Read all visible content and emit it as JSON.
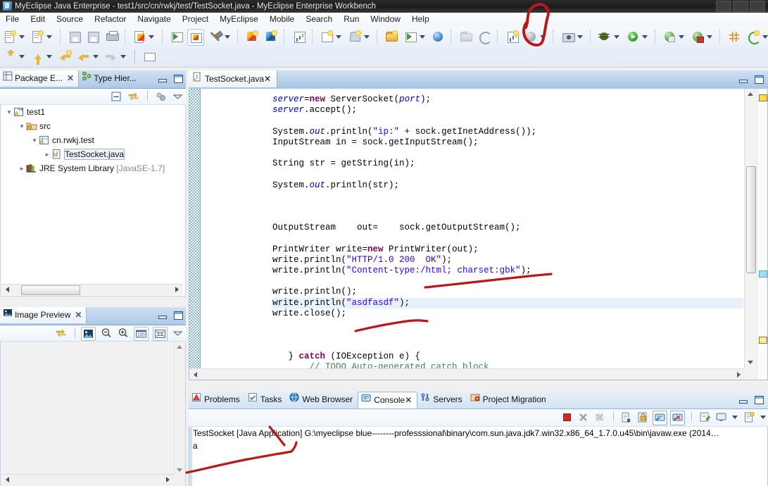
{
  "window": {
    "title": "MyEclipse Java Enterprise - test1/src/cn/rwkj/test/TestSocket.java - MyEclipse Enterprise Workbench",
    "app_icon": "myeclipse-icon"
  },
  "menubar": {
    "items": [
      "File",
      "Edit",
      "Source",
      "Refactor",
      "Navigate",
      "Project",
      "MyEclipse",
      "Mobile",
      "Search",
      "Run",
      "Window",
      "Help"
    ]
  },
  "toolbar": {
    "row1": [
      {
        "name": "new-wizard-button",
        "icon": "new-file-icon",
        "dropdown": true
      },
      {
        "name": "new-java-class-button",
        "icon": "new-class-icon",
        "dropdown": true
      },
      {
        "name": "save-button",
        "icon": "save-icon",
        "dropdown": false,
        "disabled": true
      },
      {
        "name": "save-all-button",
        "icon": "save-all-icon",
        "dropdown": false,
        "disabled": true
      },
      {
        "name": "print-button",
        "icon": "print-icon",
        "dropdown": false
      },
      {
        "name": "deploy-button",
        "icon": "deploy-icon",
        "dropdown": true
      },
      {
        "name": "run-server-button",
        "icon": "server-run-icon",
        "dropdown": false
      },
      {
        "name": "stop-server-button",
        "icon": "server-stop-icon",
        "dropdown": false,
        "framed": true
      },
      {
        "name": "build-button",
        "icon": "hammer-icon",
        "dropdown": true
      },
      {
        "name": "new-package-button",
        "icon": "package-yellow-icon",
        "dropdown": false
      },
      {
        "name": "new-jar-button",
        "icon": "package-blue-icon",
        "dropdown": false
      },
      {
        "name": "browser-20-button",
        "icon": "web-20-icon",
        "dropdown": false
      },
      {
        "name": "new-ui-button",
        "icon": "ui-wizard-icon",
        "dropdown": true
      },
      {
        "name": "new-db-wizard-button",
        "icon": "db-wizard-icon",
        "dropdown": true
      },
      {
        "name": "new-server-button",
        "icon": "server-new-icon",
        "dropdown": false
      },
      {
        "name": "run-server-green-button",
        "icon": "server-green-run-icon",
        "dropdown": true
      },
      {
        "name": "open-browser-button",
        "icon": "globe-icon",
        "dropdown": false
      },
      {
        "name": "open-folder-button",
        "icon": "open-folder-icon",
        "dropdown": false,
        "disabled": true
      },
      {
        "name": "refresh-button",
        "icon": "refresh-icon",
        "dropdown": false
      },
      {
        "name": "report-button",
        "icon": "report-icon",
        "dropdown": false
      },
      {
        "name": "globe-disabled-button",
        "icon": "globe-disabled-icon",
        "dropdown": true
      },
      {
        "name": "snapshot-button",
        "icon": "camera-icon",
        "dropdown": true
      },
      {
        "name": "debug-button",
        "icon": "debug-bug-icon",
        "dropdown": true
      },
      {
        "name": "run-button",
        "icon": "run-green-play-icon",
        "dropdown": true,
        "highlighted": true
      },
      {
        "name": "run-config-button",
        "icon": "run-config-icon",
        "dropdown": true
      },
      {
        "name": "run-external-button",
        "icon": "run-external-icon",
        "dropdown": true
      },
      {
        "name": "new-table-button",
        "icon": "table-grid-icon",
        "dropdown": false
      },
      {
        "name": "generate-button",
        "icon": "generate-circle-icon",
        "dropdown": true
      },
      {
        "name": "open-type-button",
        "icon": "open-type-icon",
        "dropdown": false
      },
      {
        "name": "open-resource-button",
        "icon": "open-resource-icon",
        "dropdown": false
      },
      {
        "name": "search-button",
        "icon": "pen-search-icon",
        "dropdown": true
      },
      {
        "name": "open-task-button",
        "icon": "task-icon",
        "dropdown": false
      },
      {
        "name": "team-sync-button",
        "icon": "team-sync-icon",
        "dropdown": false
      },
      {
        "name": "perspective-button",
        "icon": "perspective-icon",
        "dropdown": false,
        "framed": true
      }
    ],
    "row2": [
      {
        "name": "prev-annotation-button",
        "icon": "arrow-down-yellow-icon",
        "dropdown": true
      },
      {
        "name": "next-annotation-button",
        "icon": "arrow-up-yellow-icon",
        "dropdown": true
      },
      {
        "name": "last-edit-button",
        "icon": "back-edit-icon",
        "dropdown": false
      },
      {
        "name": "back-button",
        "icon": "back-arrow-icon",
        "dropdown": true
      },
      {
        "name": "forward-button",
        "icon": "forward-arrow-icon",
        "dropdown": true,
        "disabled": true
      },
      {
        "name": "new-untitled-button",
        "icon": "new-untitled-icon",
        "dropdown": false
      }
    ]
  },
  "package_explorer": {
    "tabs": [
      {
        "label": "Package E...",
        "icon": "package-explorer-icon",
        "active": true,
        "closable": true
      },
      {
        "label": "Type Hier...",
        "icon": "type-hierarchy-icon",
        "active": false,
        "closable": false
      }
    ],
    "view_buttons": [
      {
        "name": "collapse-all-button",
        "icon": "collapse-all-icon"
      },
      {
        "name": "link-with-editor-button",
        "icon": "link-editor-icon"
      },
      {
        "name": "focus-on-active-task-button",
        "icon": "focus-task-icon"
      },
      {
        "name": "view-menu-button",
        "icon": "view-menu-chevron-icon"
      }
    ],
    "tree": [
      {
        "label": "test1",
        "indent": 0,
        "twist": "expanded",
        "icon": "java-project-icon",
        "dim": "",
        "selected": false
      },
      {
        "label": "src",
        "indent": 1,
        "twist": "expanded",
        "icon": "source-folder-icon",
        "dim": "",
        "selected": false
      },
      {
        "label": "cn.rwkj.test",
        "indent": 2,
        "twist": "expanded",
        "icon": "package-icon",
        "dim": "",
        "selected": false
      },
      {
        "label": "TestSocket.java",
        "indent": 3,
        "twist": "collapsed",
        "icon": "java-file-warning-icon",
        "dim": "",
        "selected": true
      },
      {
        "label": "JRE System Library",
        "indent": 1,
        "twist": "collapsed",
        "icon": "jre-library-icon",
        "dim": "[JavaSE-1.7]",
        "selected": false
      }
    ]
  },
  "image_preview": {
    "tab": {
      "label": "Image Preview",
      "icon": "image-preview-icon",
      "closable": true
    },
    "toolbar_buttons": [
      {
        "name": "link-with-editor-button",
        "icon": "link-editor-icon"
      },
      {
        "name": "toggle-transparency-button",
        "icon": "image-transparency-icon"
      },
      {
        "name": "zoom-out-button",
        "icon": "zoom-out-icon"
      },
      {
        "name": "zoom-in-button",
        "icon": "zoom-in-icon"
      },
      {
        "name": "zoom-100-button",
        "icon": "zoom-100-icon",
        "label": "100"
      },
      {
        "name": "fit-to-window-button",
        "icon": "fit-window-icon"
      },
      {
        "name": "view-menu-button",
        "icon": "view-menu-chevron-icon"
      }
    ]
  },
  "editor": {
    "tab": {
      "label": "TestSocket.java",
      "icon": "java-file-warning-icon",
      "closable": true
    },
    "controls": [
      {
        "name": "minimize-button",
        "icon": "minimize-icon"
      },
      {
        "name": "maximize-button",
        "icon": "maximize-icon"
      }
    ],
    "code_lines": [
      {
        "html": "<span class=\"fld\">server</span>=<span class=\"kw\">new</span> ServerSocket(<span class=\"fld\">port</span>);",
        "highlight": false
      },
      {
        "html": "<span class=\"fld\">server</span>.accept();",
        "highlight": false
      },
      {
        "html": "",
        "highlight": false
      },
      {
        "html": "System.<span class=\"fld\">out</span>.println(<span class=\"str\">\"ip:\"</span> + sock.getInetAddress());",
        "highlight": false
      },
      {
        "html": "InputStream in = sock.getInputStream();",
        "highlight": false
      },
      {
        "html": "",
        "highlight": false
      },
      {
        "html": "String str = getString(in);",
        "highlight": false
      },
      {
        "html": "",
        "highlight": false
      },
      {
        "html": "System.<span class=\"fld\">out</span>.println(str);",
        "highlight": false
      },
      {
        "html": "",
        "highlight": false
      },
      {
        "html": "",
        "highlight": false
      },
      {
        "html": "",
        "highlight": false
      },
      {
        "html": "OutputStream    out=    sock.getOutputStream();",
        "highlight": false
      },
      {
        "html": "",
        "highlight": false
      },
      {
        "html": "PrintWriter write=<span class=\"kw\">new</span> PrintWriter(out);",
        "highlight": false
      },
      {
        "html": "write.println(<span class=\"str\">\"HTTP/1.0 200  OK\"</span>);",
        "highlight": false
      },
      {
        "html": "write.println(<span class=\"str\">\"Content-type:/html; charset:gbk\"</span>);",
        "highlight": false
      },
      {
        "html": "",
        "highlight": false
      },
      {
        "html": "write.println();",
        "highlight": false
      },
      {
        "html": "write.println(<span class=\"str\">\"asdfasdf\"</span>);",
        "highlight": true
      },
      {
        "html": "write.close();",
        "highlight": false
      },
      {
        "html": "",
        "highlight": false
      },
      {
        "html": "",
        "highlight": false
      },
      {
        "html": "",
        "highlight": false
      },
      {
        "html": "   } <span class=\"kw\">catch</span> (IOException e) {",
        "highlight": false
      },
      {
        "html": "       <span class=\"cmt\">// TODO Auto-generated catch block</span>",
        "highlight": false
      }
    ]
  },
  "bottom_panel": {
    "tabs": [
      {
        "label": "Problems",
        "icon": "problems-icon",
        "active": false,
        "closable": false
      },
      {
        "label": "Tasks",
        "icon": "tasks-icon",
        "active": false,
        "closable": false
      },
      {
        "label": "Web Browser",
        "icon": "web-browser-icon",
        "active": false,
        "closable": false
      },
      {
        "label": "Console",
        "icon": "console-icon",
        "active": true,
        "closable": true
      },
      {
        "label": "Servers",
        "icon": "servers-icon",
        "active": false,
        "closable": false
      },
      {
        "label": "Project Migration",
        "icon": "project-migration-icon",
        "active": false,
        "closable": false
      }
    ],
    "controls": [
      {
        "name": "minimize-button",
        "icon": "minimize-icon"
      },
      {
        "name": "maximize-button",
        "icon": "maximize-icon"
      }
    ],
    "console_toolbar": [
      {
        "name": "terminate-button",
        "icon": "terminate-red-square-icon"
      },
      {
        "name": "remove-launch-button",
        "icon": "remove-launch-icon"
      },
      {
        "name": "remove-all-terminated-button",
        "icon": "remove-all-icon"
      },
      {
        "name": "clear-console-button",
        "icon": "clear-console-icon"
      },
      {
        "name": "scroll-lock-button",
        "icon": "scroll-lock-icon"
      },
      {
        "name": "show-console-on-output-button",
        "icon": "show-console-output-icon",
        "toggled": true
      },
      {
        "name": "show-console-on-error-button",
        "icon": "show-console-error-icon",
        "toggled": true
      },
      {
        "name": "pin-console-button",
        "icon": "pin-console-icon"
      },
      {
        "name": "display-selected-console-button",
        "icon": "display-console-icon",
        "dropdown": true
      },
      {
        "name": "open-console-button",
        "icon": "open-console-icon",
        "dropdown": true
      }
    ],
    "console_header": "TestSocket [Java Application] G:\\myeclipse blue--------professsional\\binary\\com.sun.java.jdk7.win32.x86_64_1.7.0.u45\\bin\\javaw.exe (2014…",
    "console_output": "a"
  },
  "annotations": {
    "run_button_circle": "red-hand-drawn-circle-around-run-button",
    "underline_content_type": "red-underline-near-content-type-line",
    "underline_write_close": "red-underline-near-write-close-line",
    "underline_console_output": "red-underline-under-console-output"
  },
  "colors": {
    "accent_blue": "#3a6ea5",
    "tab_active_bg": "#ffffff",
    "keyword": "#7f0055",
    "string": "#2a00ff",
    "field": "#0000c0",
    "comment": "#3f7f5f",
    "annotation_red": "#c00000",
    "titlebar_bg": "#1b1b1b"
  }
}
